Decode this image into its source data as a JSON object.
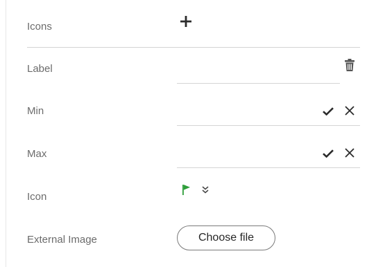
{
  "rows": {
    "icons": {
      "label": "Icons"
    },
    "label": {
      "label": "Label",
      "value": ""
    },
    "min": {
      "label": "Min",
      "value": ""
    },
    "max": {
      "label": "Max",
      "value": ""
    },
    "icon": {
      "label": "Icon"
    },
    "external_image": {
      "label": "External Image",
      "button_label": "Choose file"
    }
  },
  "icons": {
    "add": "plus-icon",
    "delete": "trash-icon",
    "confirm": "check-icon",
    "cancel": "close-icon",
    "selected_icon": "flag-icon",
    "expand": "double-chevron-down-icon"
  },
  "colors": {
    "flag": "#2e9e3a",
    "icon_dark": "#2b2b2b",
    "label_text": "#6b6b6b"
  }
}
